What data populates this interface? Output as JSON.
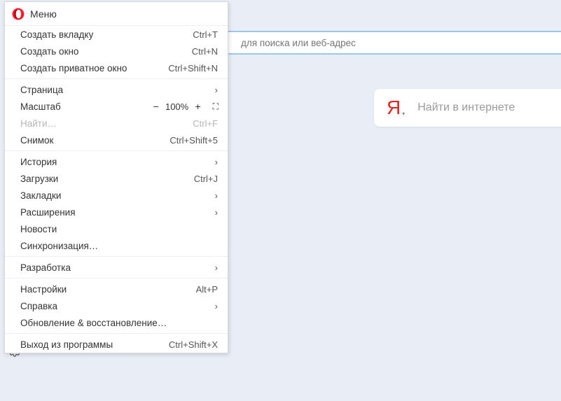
{
  "menu": {
    "title": "Меню",
    "groups": [
      [
        {
          "id": "new-tab",
          "label": "Создать вкладку",
          "hint": "Ctrl+T"
        },
        {
          "id": "new-window",
          "label": "Создать окно",
          "hint": "Ctrl+N"
        },
        {
          "id": "new-priv",
          "label": "Создать приватное окно",
          "hint": "Ctrl+Shift+N"
        }
      ],
      [
        {
          "id": "page",
          "label": "Страница",
          "submenu": true
        },
        {
          "id": "zoom",
          "label": "Масштаб",
          "zoom": true,
          "pct": "100%"
        },
        {
          "id": "find",
          "label": "Найти…",
          "hint": "Ctrl+F",
          "disabled": true
        },
        {
          "id": "snapshot",
          "label": "Снимок",
          "hint": "Ctrl+Shift+5"
        }
      ],
      [
        {
          "id": "history",
          "label": "История",
          "submenu": true
        },
        {
          "id": "downloads",
          "label": "Загрузки",
          "hint": "Ctrl+J"
        },
        {
          "id": "bookmarks",
          "label": "Закладки",
          "submenu": true
        },
        {
          "id": "extensions",
          "label": "Расширения",
          "submenu": true
        },
        {
          "id": "news",
          "label": "Новости"
        },
        {
          "id": "sync",
          "label": "Синхронизация…"
        }
      ],
      [
        {
          "id": "develop",
          "label": "Разработка",
          "submenu": true
        }
      ],
      [
        {
          "id": "settings",
          "label": "Настройки",
          "hint": "Alt+P"
        },
        {
          "id": "help",
          "label": "Справка",
          "submenu": true
        },
        {
          "id": "recovery",
          "label": "Обновление & восстановление…"
        }
      ],
      [
        {
          "id": "exit",
          "label": "Выход из программы",
          "hint": "Ctrl+Shift+X"
        }
      ]
    ]
  },
  "address_bar": {
    "placeholder": "для поиска или веб-адрес"
  },
  "search_card": {
    "brand_letter": "Я",
    "placeholder": "Найти в интернете"
  }
}
